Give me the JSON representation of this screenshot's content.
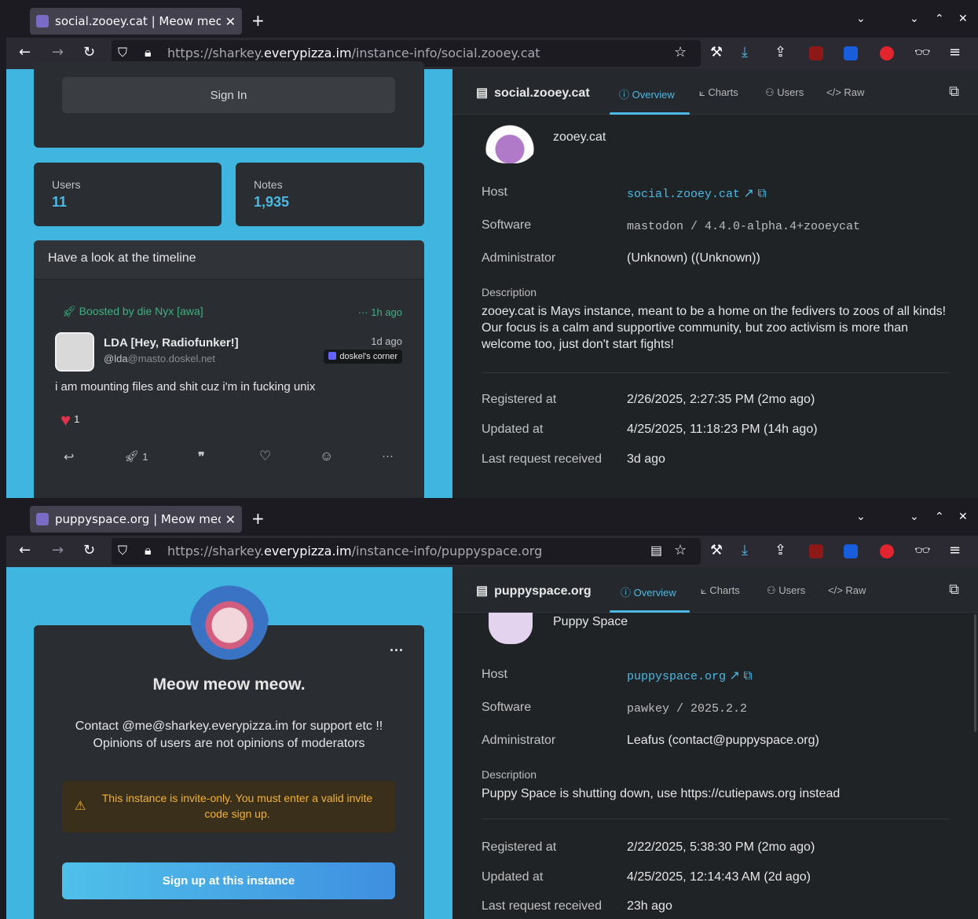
{
  "window1": {
    "tab_title": "social.zooey.cat | Meow meow",
    "url_prefix": "https://sharkey.",
    "url_domain": "everypizza.im",
    "url_path": "/instance-info/social.zooey.cat",
    "left": {
      "sign_in_label": "Sign In",
      "users_label": "Users",
      "users_value": "11",
      "notes_label": "Notes",
      "notes_value": "1,935",
      "timeline_title": "Have a look at the timeline",
      "boosted_by_prefix": "Boosted by ",
      "boosted_by_name": "die Nyx [awa]",
      "boost_time": "1h ago",
      "author_name": "LDA [Hey, Radiofunker!]",
      "author_handle_user": "@lda",
      "author_handle_host": "@masto.doskel.net",
      "post_time": "1d ago",
      "instance_badge": "doskel's corner",
      "post_text": "i am mounting files and shit cuz i'm in fucking unix",
      "reaction_count": "1",
      "renote_count": "1"
    },
    "right": {
      "site_name": "social.zooey.cat",
      "tabs": [
        "Overview",
        "Charts",
        "Users",
        "Raw"
      ],
      "instance_name": "zooey.cat",
      "host_label": "Host",
      "host_value": "social.zooey.cat",
      "software_label": "Software",
      "software_value": "mastodon / 4.4.0-alpha.4+zooeycat",
      "admin_label": "Administrator",
      "admin_value": "(Unknown) ((Unknown))",
      "description_label": "Description",
      "description": "zooey.cat is Mays instance, meant to be a home on the fedivers to zoos of all kinds! Our focus is a calm and supportive community, but zoo activism is more than welcome too, just don't start fights!",
      "registered_label": "Registered at",
      "registered_value": "2/26/2025, 2:27:35 PM (2mo ago)",
      "updated_label": "Updated at",
      "updated_value": "4/25/2025, 11:18:23 PM (14h ago)",
      "last_request_label": "Last request received",
      "last_request_value": "3d ago"
    }
  },
  "window2": {
    "tab_title": "puppyspace.org | Meow meow",
    "url_prefix": "https://sharkey.",
    "url_domain": "everypizza.im",
    "url_path": "/instance-info/puppyspace.org",
    "left": {
      "server_name": "Meow meow meow.",
      "server_description_1": "Contact @me@sharkey.everypizza.im for support etc !!",
      "server_description_2": "Opinions of users are not opinions of moderators",
      "invite_warning": "This instance is invite-only. You must enter a valid invite code sign up.",
      "signup_label": "Sign up at this instance",
      "more_label": "···"
    },
    "right": {
      "site_name": "puppyspace.org",
      "tabs": [
        "Overview",
        "Charts",
        "Users",
        "Raw"
      ],
      "instance_name": "Puppy Space",
      "host_label": "Host",
      "host_value": "puppyspace.org",
      "software_label": "Software",
      "software_value": "pawkey / 2025.2.2",
      "admin_label": "Administrator",
      "admin_value": "Leafus (contact@puppyspace.org)",
      "description_label": "Description",
      "description": "Puppy Space is shutting down, use https://cutiepaws.org instead",
      "registered_label": "Registered at",
      "registered_value": "2/22/2025, 5:38:30 PM (2mo ago)",
      "updated_label": "Updated at",
      "updated_value": "4/25/2025, 12:14:43 AM (2d ago)",
      "last_request_label": "Last request received",
      "last_request_value": "23h ago"
    }
  },
  "colors": {
    "accent": "#4bb9e4",
    "boost_green": "#3fb07f",
    "heart": "#e0344b",
    "warning_bg": "#3a2f1a",
    "warning_text": "#f2b134"
  }
}
